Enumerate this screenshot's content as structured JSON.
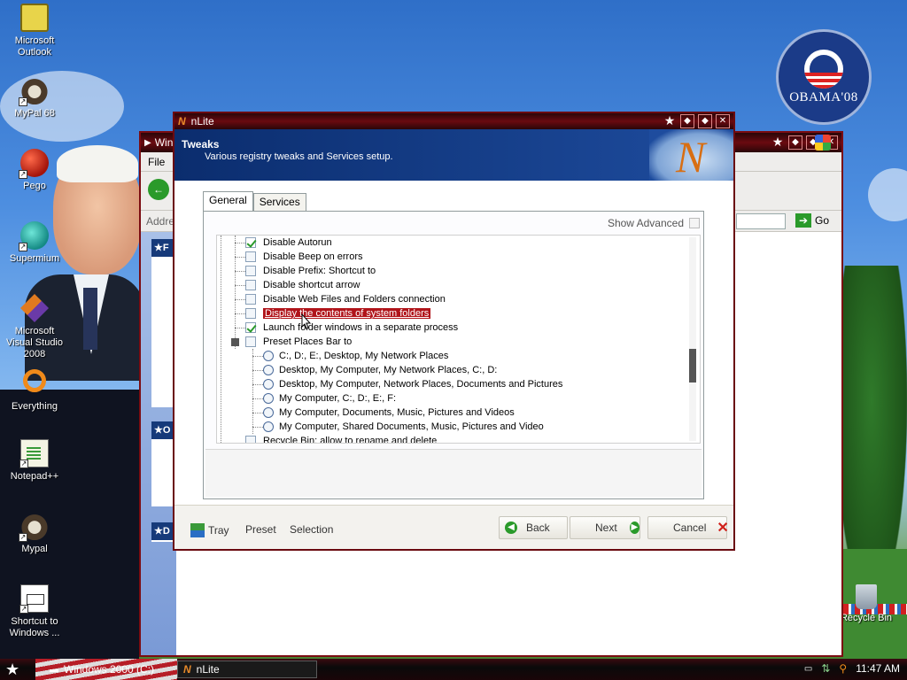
{
  "desktop": {
    "icons": [
      {
        "label": "Microsoft Outlook",
        "icon": "outlook-icon"
      },
      {
        "label": "MyPal 68",
        "icon": "mypal-icon"
      },
      {
        "label": "Pego",
        "icon": "pego-icon"
      },
      {
        "label": "Supermium",
        "icon": "supermium-icon"
      },
      {
        "label": "Microsoft Visual Studio 2008",
        "icon": "visual-studio-icon"
      },
      {
        "label": "Everything",
        "icon": "everything-icon"
      },
      {
        "label": "Notepad++",
        "icon": "notepadpp-icon"
      },
      {
        "label": "Mypal",
        "icon": "mypal-icon"
      },
      {
        "label": "Shortcut to Windows ...",
        "icon": "shortcut-icon"
      },
      {
        "label": "Recycle Bin",
        "icon": "recycle-bin-icon"
      }
    ],
    "badge_text": "OBAMA'08"
  },
  "back_window": {
    "title": "Win",
    "menu": "File",
    "address_label": "Addres",
    "go_label": "Go"
  },
  "nlite": {
    "title": "nLite",
    "header_title": "Tweaks",
    "header_subtitle": "Various registry tweaks and Services setup.",
    "tabs": [
      "General",
      "Services"
    ],
    "show_advanced": "Show Advanced",
    "tree_items": [
      {
        "label": "Disable Autorun",
        "checked": true,
        "kind": "checkbox"
      },
      {
        "label": "Disable Beep on errors",
        "checked": false,
        "kind": "checkbox"
      },
      {
        "label": "Disable Prefix: Shortcut to",
        "checked": false,
        "kind": "checkbox"
      },
      {
        "label": "Disable shortcut arrow",
        "checked": false,
        "kind": "checkbox"
      },
      {
        "label": "Disable Web Files and Folders connection",
        "checked": false,
        "kind": "checkbox"
      },
      {
        "label": "Display the contents of system folders",
        "checked": false,
        "kind": "checkbox",
        "selected": true
      },
      {
        "label": "Launch folder windows in a separate process",
        "checked": true,
        "kind": "checkbox"
      },
      {
        "label": "Preset Places Bar to",
        "checked": false,
        "kind": "checkbox"
      },
      {
        "label": "C:, D:, E:, Desktop, My Network Places",
        "kind": "radio"
      },
      {
        "label": "Desktop, My Computer, My Network Places, C:, D:",
        "kind": "radio"
      },
      {
        "label": "Desktop, My Computer, Network Places, Documents and Pictures",
        "kind": "radio"
      },
      {
        "label": "My Computer, C:, D:, E:, F:",
        "kind": "radio"
      },
      {
        "label": "My Computer, Documents, Music, Pictures and Videos",
        "kind": "radio"
      },
      {
        "label": "My Computer, Shared Documents, Music, Pictures and Video",
        "kind": "radio"
      },
      {
        "label": "Recycle Bin: allow to rename and delete",
        "checked": false,
        "kind": "checkbox"
      }
    ],
    "footer": {
      "tray": "Tray",
      "preset": "Preset",
      "selection": "Selection",
      "back": "Back",
      "next": "Next",
      "cancel": "Cancel"
    }
  },
  "taskbar": {
    "items": [
      "Windows 2000 (C:)",
      "nLite"
    ],
    "clock": "11:47 AM"
  }
}
